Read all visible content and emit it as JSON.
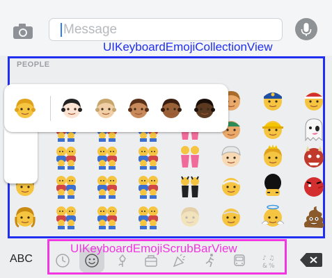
{
  "message_field": {
    "placeholder": "Message"
  },
  "keyboard": {
    "collection_label": "UIKeyboardEmojiCollectionView",
    "section_title": "PEOPLE",
    "scrub_label": "UIKeyboardEmojiScrubBarView",
    "abc_label": "ABC"
  },
  "colors": {
    "collection_outline": "#1f2ef0",
    "scrub_outline": "#f037e0",
    "caret": "#2f7cf6"
  },
  "icons": [
    "camera-icon",
    "microphone-icon",
    "recent-icon",
    "smiley-icon",
    "flower-icon",
    "bell-icon",
    "car-icon",
    "symbols-icon",
    "backspace-icon"
  ]
}
